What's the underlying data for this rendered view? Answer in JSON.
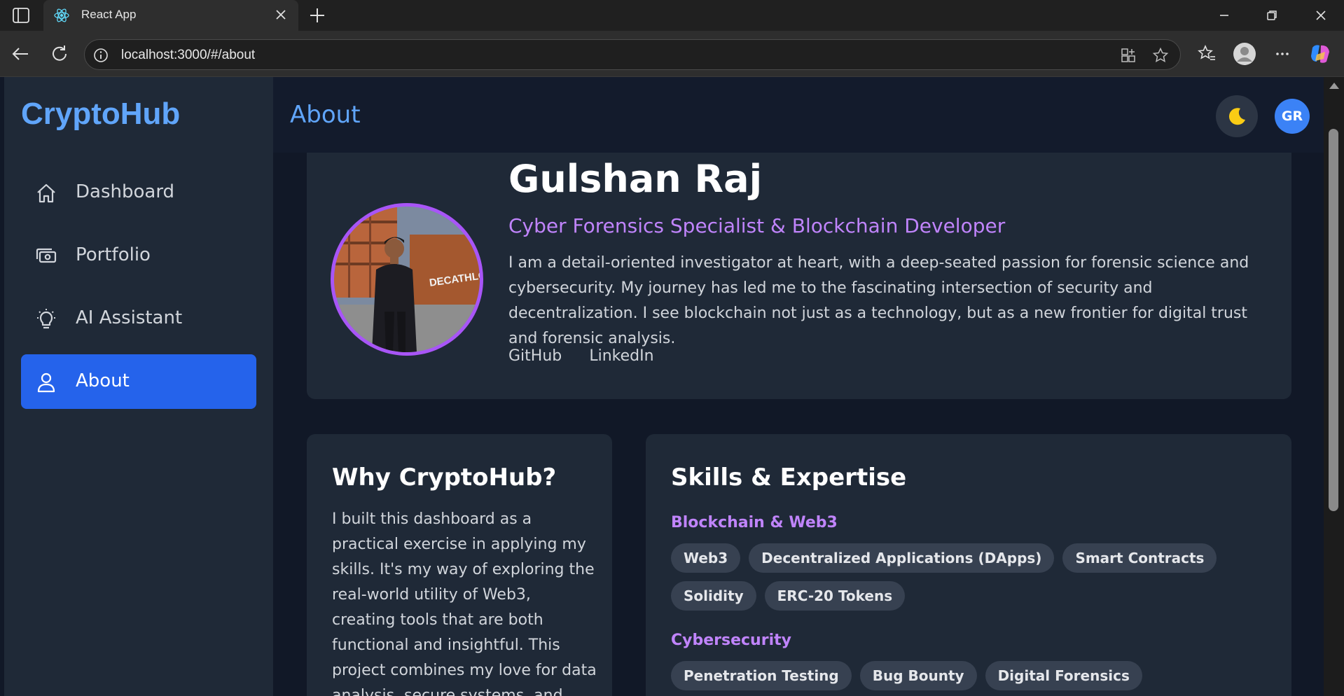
{
  "browser": {
    "tab_title": "React App",
    "url": "localhost:3000/#/about"
  },
  "app": {
    "brand": "CryptoHub",
    "nav": [
      {
        "label": "Dashboard",
        "icon": "home-icon"
      },
      {
        "label": "Portfolio",
        "icon": "cash-icon"
      },
      {
        "label": "AI Assistant",
        "icon": "lightbulb-icon"
      },
      {
        "label": "About",
        "icon": "user-icon",
        "active": true
      }
    ],
    "header": {
      "title": "About",
      "user_initials": "GR"
    }
  },
  "profile": {
    "name": "Gulshan Raj",
    "role": "Cyber Forensics Specialist & Blockchain Developer",
    "bio": "I am a detail-oriented investigator at heart, with a deep-seated passion for forensic science and cybersecurity. My journey has led me to the fascinating intersection of security and decentralization. I see blockchain not just as a technology, but as a new frontier for digital trust and forensic analysis.",
    "links": [
      "GitHub",
      "LinkedIn"
    ],
    "photo_sign": "DECATHLON"
  },
  "why": {
    "title": "Why CryptoHub?",
    "text": "I built this dashboard as a practical exercise in applying my skills. It's my way of exploring the real-world utility of Web3, creating tools that are both functional and insightful. This project combines my love for data analysis, secure systems, and"
  },
  "skills": {
    "title": "Skills & Expertise",
    "groups": [
      {
        "title": "Blockchain & Web3",
        "items": [
          "Web3",
          "Decentralized Applications (DApps)",
          "Smart Contracts",
          "Solidity",
          "ERC-20 Tokens"
        ]
      },
      {
        "title": "Cybersecurity",
        "items": [
          "Penetration Testing",
          "Bug Bounty",
          "Digital Forensics"
        ]
      }
    ]
  },
  "colors": {
    "accent_blue": "#60a5fa",
    "active_nav": "#2563eb",
    "purple": "#c084fc",
    "card_bg": "#1f2937",
    "page_bg": "#111827"
  }
}
